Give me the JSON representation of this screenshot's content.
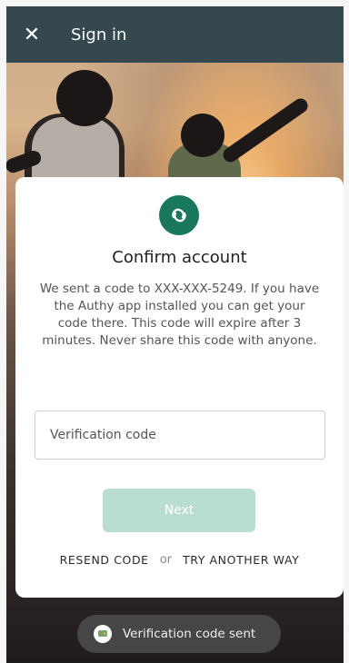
{
  "header": {
    "close_icon": "close-icon",
    "close_glyph": "✕",
    "title": "Sign in",
    "background_color": "#35474f"
  },
  "card": {
    "logo_icon": "authy-logo-icon",
    "logo_color": "#19775e",
    "title": "Confirm account",
    "description": "We sent a code to XXX-XXX-5249. If you have the Authy app installed you can get your code there. This code will expire after 3 minutes. Never share this code with anyone.",
    "input_placeholder": "Verification code",
    "input_value": "",
    "next_label": "Next",
    "next_color": "#b9dcd3",
    "resend_label": "RESEND CODE",
    "or_label": "or",
    "try_another_label": "TRY ANOTHER WAY"
  },
  "toast": {
    "icon": "message-icon",
    "text": "Verification code sent"
  }
}
